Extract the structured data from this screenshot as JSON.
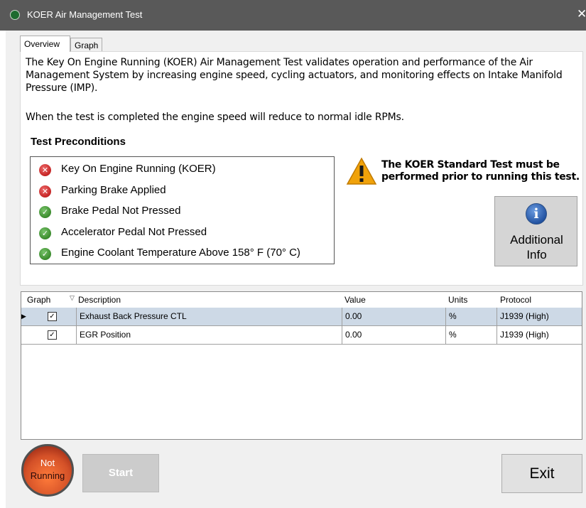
{
  "window": {
    "title": "KOER Air Management Test",
    "close_glyph": "✕",
    "icon": "app-icon"
  },
  "tabs": [
    {
      "label": "Overview",
      "active": true
    },
    {
      "label": "Graph",
      "active": false
    }
  ],
  "overview": {
    "intro": "The Key On Engine Running (KOER) Air Management Test validates operation and performance of the Air Management System by increasing engine speed, cycling actuators, and monitoring effects on Intake Manifold Pressure (IMP).",
    "completed_note": "When the test is completed the engine speed will reduce to normal idle RPMs.",
    "preconditions_title": "Test Preconditions",
    "preconditions": [
      {
        "label": "Key On Engine Running (KOER)",
        "status": "fail",
        "glyph": "✕"
      },
      {
        "label": "Parking Brake Applied",
        "status": "fail",
        "glyph": "✕"
      },
      {
        "label": "Brake Pedal Not Pressed",
        "status": "pass",
        "glyph": "✓"
      },
      {
        "label": "Accelerator Pedal Not Pressed",
        "status": "pass",
        "glyph": "✓"
      },
      {
        "label": "Engine Coolant Temperature Above 158° F (70° C)",
        "status": "pass",
        "glyph": "✓"
      }
    ],
    "warning": "The KOER Standard Test must be performed prior to running this test.",
    "info_button": {
      "line1": "Additional",
      "line2": "Info",
      "icon_glyph": "i"
    }
  },
  "grid": {
    "columns": {
      "graph": "Graph",
      "description": "Description",
      "value": "Value",
      "units": "Units",
      "protocol": "Protocol"
    },
    "rows": [
      {
        "graph": true,
        "check": "✓",
        "description": "Exhaust Back Pressure CTL",
        "value": "0.00",
        "units": "%",
        "protocol": "J1939 (High)",
        "selected": true,
        "indicator": "▶"
      },
      {
        "graph": true,
        "check": "✓",
        "description": "EGR Position",
        "value": "0.00",
        "units": "%",
        "protocol": "J1939 (High)",
        "selected": false,
        "indicator": ""
      }
    ]
  },
  "footer": {
    "status_line1": "Not",
    "status_line2": "Running",
    "start_label": "Start",
    "exit_label": "Exit"
  },
  "colors": {
    "titlebar": "#595959",
    "selected_row": "#cdd9e6",
    "status_fail": "#c42424",
    "status_pass": "#3a8a2c",
    "warning": "#f0a20a",
    "info": "#1f4f9e"
  }
}
